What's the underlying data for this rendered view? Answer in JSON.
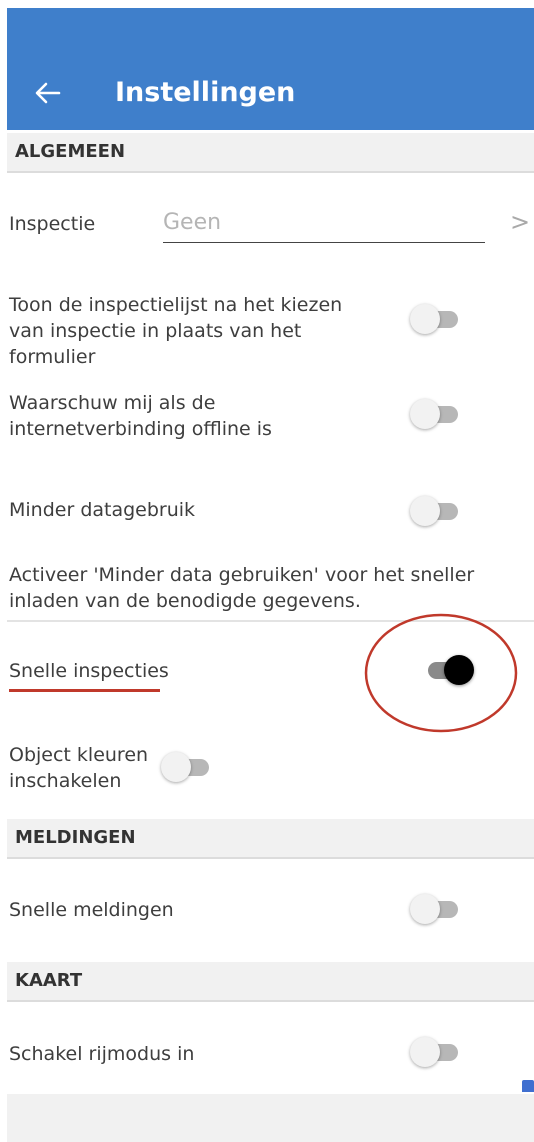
{
  "header": {
    "title": "Instellingen",
    "back_icon": "arrow-left-icon"
  },
  "sections": {
    "algemeen": "ALGEMEEN",
    "meldingen": "MELDINGEN",
    "kaart": "KAART"
  },
  "inspectie": {
    "label": "Inspectie",
    "placeholder": "Geen",
    "chevron": ">"
  },
  "settings": {
    "toon_lijst": {
      "label": "Toon de inspectielijst na het kiezen van inspectie in plaats van het formulier",
      "enabled": false
    },
    "waarschuw": {
      "label": "Waarschuw mij als de internetverbinding offline is",
      "enabled": false
    },
    "minder_data": {
      "label": "Minder datagebruik",
      "enabled": false
    },
    "minder_data_help": "Activeer 'Minder data gebruiken' voor het sneller inladen van de benodigde gegevens.",
    "snelle_inspecties": {
      "label": "Snelle inspecties",
      "enabled": true
    },
    "object_kleuren": {
      "label": "Object kleuren inschakelen",
      "enabled": false
    },
    "snelle_meldingen": {
      "label": "Snelle meldingen",
      "enabled": false
    },
    "rijmodus": {
      "label": "Schakel rijmodus in",
      "enabled": false
    }
  },
  "colors": {
    "appbar": "#3f7fcb",
    "annotation": "#c0392b"
  }
}
